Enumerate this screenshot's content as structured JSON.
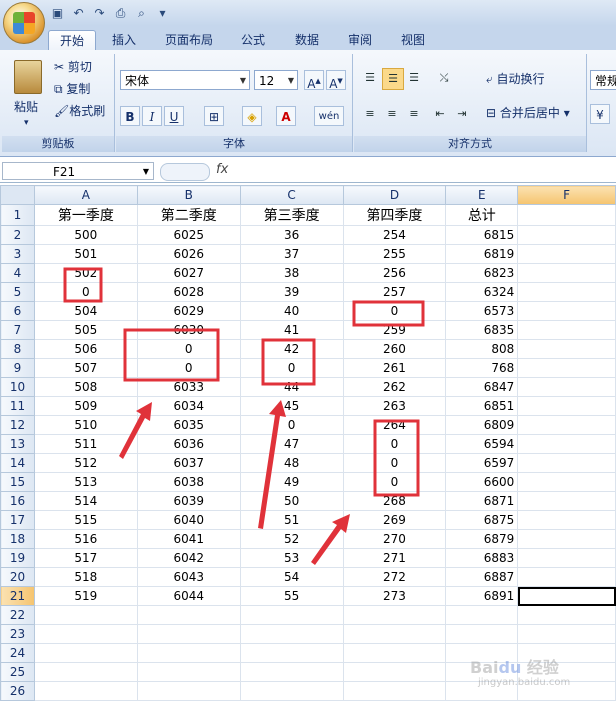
{
  "ribbon": {
    "tabs": [
      "开始",
      "插入",
      "页面布局",
      "公式",
      "数据",
      "审阅",
      "视图"
    ],
    "clipboard": {
      "paste": "粘贴",
      "cut": "剪切",
      "copy": "复制",
      "format_painter": "格式刷",
      "label": "剪贴板"
    },
    "font": {
      "name": "宋体",
      "size": "12",
      "label": "字体"
    },
    "alignment": {
      "wrap": "自动换行",
      "merge": "合并后居中",
      "label": "对齐方式"
    },
    "number_format": "常规"
  },
  "formula_bar": {
    "name_box": "F21",
    "fx": "fx",
    "value": ""
  },
  "sheet": {
    "columns": [
      "A",
      "B",
      "C",
      "D",
      "E",
      "F"
    ],
    "header_row": [
      "第一季度",
      "第二季度",
      "第三季度",
      "第四季度",
      "总计"
    ],
    "rows": [
      [
        "500",
        "6025",
        "36",
        "254",
        "6815"
      ],
      [
        "501",
        "6026",
        "37",
        "255",
        "6819"
      ],
      [
        "502",
        "6027",
        "38",
        "256",
        "6823"
      ],
      [
        "0",
        "6028",
        "39",
        "257",
        "6324"
      ],
      [
        "504",
        "6029",
        "40",
        "0",
        "6573"
      ],
      [
        "505",
        "6030",
        "41",
        "259",
        "6835"
      ],
      [
        "506",
        "0",
        "42",
        "260",
        "808"
      ],
      [
        "507",
        "0",
        "0",
        "261",
        "768"
      ],
      [
        "508",
        "6033",
        "44",
        "262",
        "6847"
      ],
      [
        "509",
        "6034",
        "45",
        "263",
        "6851"
      ],
      [
        "510",
        "6035",
        "0",
        "264",
        "6809"
      ],
      [
        "511",
        "6036",
        "47",
        "0",
        "6594"
      ],
      [
        "512",
        "6037",
        "48",
        "0",
        "6597"
      ],
      [
        "513",
        "6038",
        "49",
        "0",
        "6600"
      ],
      [
        "514",
        "6039",
        "50",
        "268",
        "6871"
      ],
      [
        "515",
        "6040",
        "51",
        "269",
        "6875"
      ],
      [
        "516",
        "6041",
        "52",
        "270",
        "6879"
      ],
      [
        "517",
        "6042",
        "53",
        "271",
        "6883"
      ],
      [
        "518",
        "6043",
        "54",
        "272",
        "6887"
      ],
      [
        "519",
        "6044",
        "55",
        "273",
        "6891"
      ]
    ],
    "row_numbers": [
      "1",
      "2",
      "3",
      "4",
      "5",
      "6",
      "7",
      "8",
      "9",
      "10",
      "11",
      "12",
      "13",
      "14",
      "15",
      "16",
      "17",
      "18",
      "19",
      "20",
      "21",
      "22",
      "23",
      "24",
      "25",
      "26"
    ],
    "active_cell": "F21",
    "annotation_color": "#e0323a"
  }
}
